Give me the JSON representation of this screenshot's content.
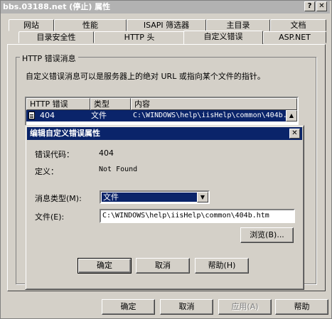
{
  "window": {
    "title": "bbs.03188.net (停止) 属性",
    "help_glyph": "?",
    "close_glyph": "✕"
  },
  "tabs": {
    "row1": [
      "网站",
      "性能",
      "ISAPI 筛选器",
      "主目录",
      "文档"
    ],
    "row2": [
      "目录安全性",
      "HTTP 头",
      "自定义错误",
      "ASP.NET"
    ],
    "active": "自定义错误"
  },
  "group": {
    "title": "HTTP 错误消息",
    "description": "自定义错误消息可以是服务器上的绝对 URL 或指向某个文件的指针。"
  },
  "listview": {
    "columns": [
      "HTTP 错误",
      "类型",
      "内容"
    ],
    "selected_row": {
      "code": "404",
      "type": "文件",
      "content": "C:\\WINDOWS\\help\\iisHelp\\common\\404b.h"
    }
  },
  "dialog": {
    "title": "编辑自定义错误属性",
    "close_glyph": "✕",
    "error_code_label": "错误代码：",
    "error_code_value": "404",
    "definition_label": "定义：",
    "definition_value": "Not Found",
    "message_type_label": "消息类型(M):",
    "message_type_value": "文件",
    "file_label": "文件(E):",
    "file_value": "C:\\WINDOWS\\help\\iisHelp\\common\\404b.htm",
    "browse_label": "浏览(B)...",
    "ok_label": "确定",
    "cancel_label": "取消",
    "help_label": "帮助(H)"
  },
  "footer": {
    "ok_label": "确定",
    "cancel_label": "取消",
    "apply_label": "应用(A)",
    "help_label": "帮助"
  }
}
